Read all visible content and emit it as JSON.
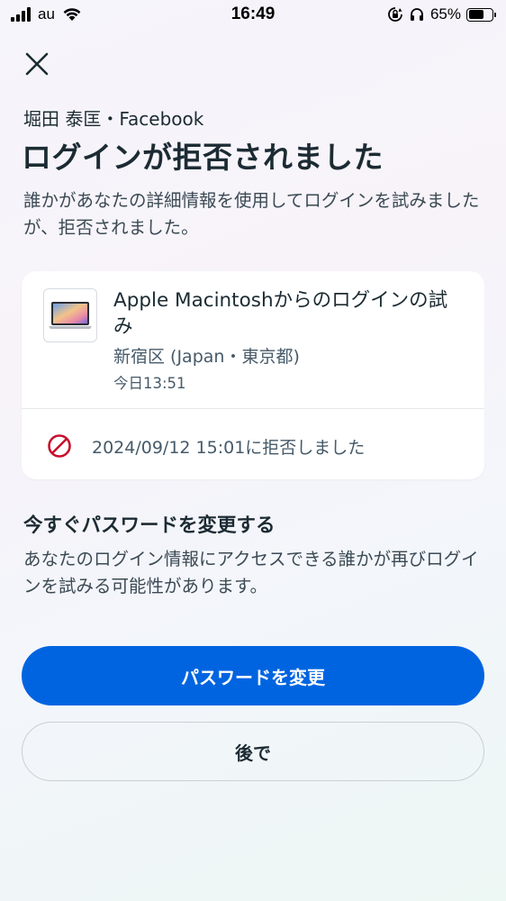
{
  "status_bar": {
    "carrier": "au",
    "time": "16:49",
    "battery_percent": "65%",
    "battery_level": 0.65,
    "icons": [
      "signal-icon",
      "wifi-icon",
      "rotation-lock-icon",
      "headphones-icon",
      "battery-icon"
    ]
  },
  "header": {
    "close_icon": "close-icon",
    "account": "堀田 泰匡・Facebook",
    "title": "ログインが拒否されました",
    "description": "誰かがあなたの詳細情報を使用してログインを試みましたが、拒否されました。"
  },
  "login_card": {
    "device_icon": "laptop-icon",
    "title": "Apple Macintoshからのログインの試み",
    "location": "新宿区 (Japan・東京都)",
    "time": "今日13:51",
    "blocked_icon": "blocked-icon",
    "blocked_text": "2024/09/12 15:01に拒否しました"
  },
  "section": {
    "title": "今すぐパスワードを変更する",
    "description": "あなたのログイン情報にアクセスできる誰かが再びログインを試みる可能性があります。"
  },
  "actions": {
    "primary_label": "パスワードを変更",
    "secondary_label": "後で"
  },
  "colors": {
    "primary": "#0064e0",
    "text": "#1c2b33",
    "blocked": "#c8102e"
  }
}
